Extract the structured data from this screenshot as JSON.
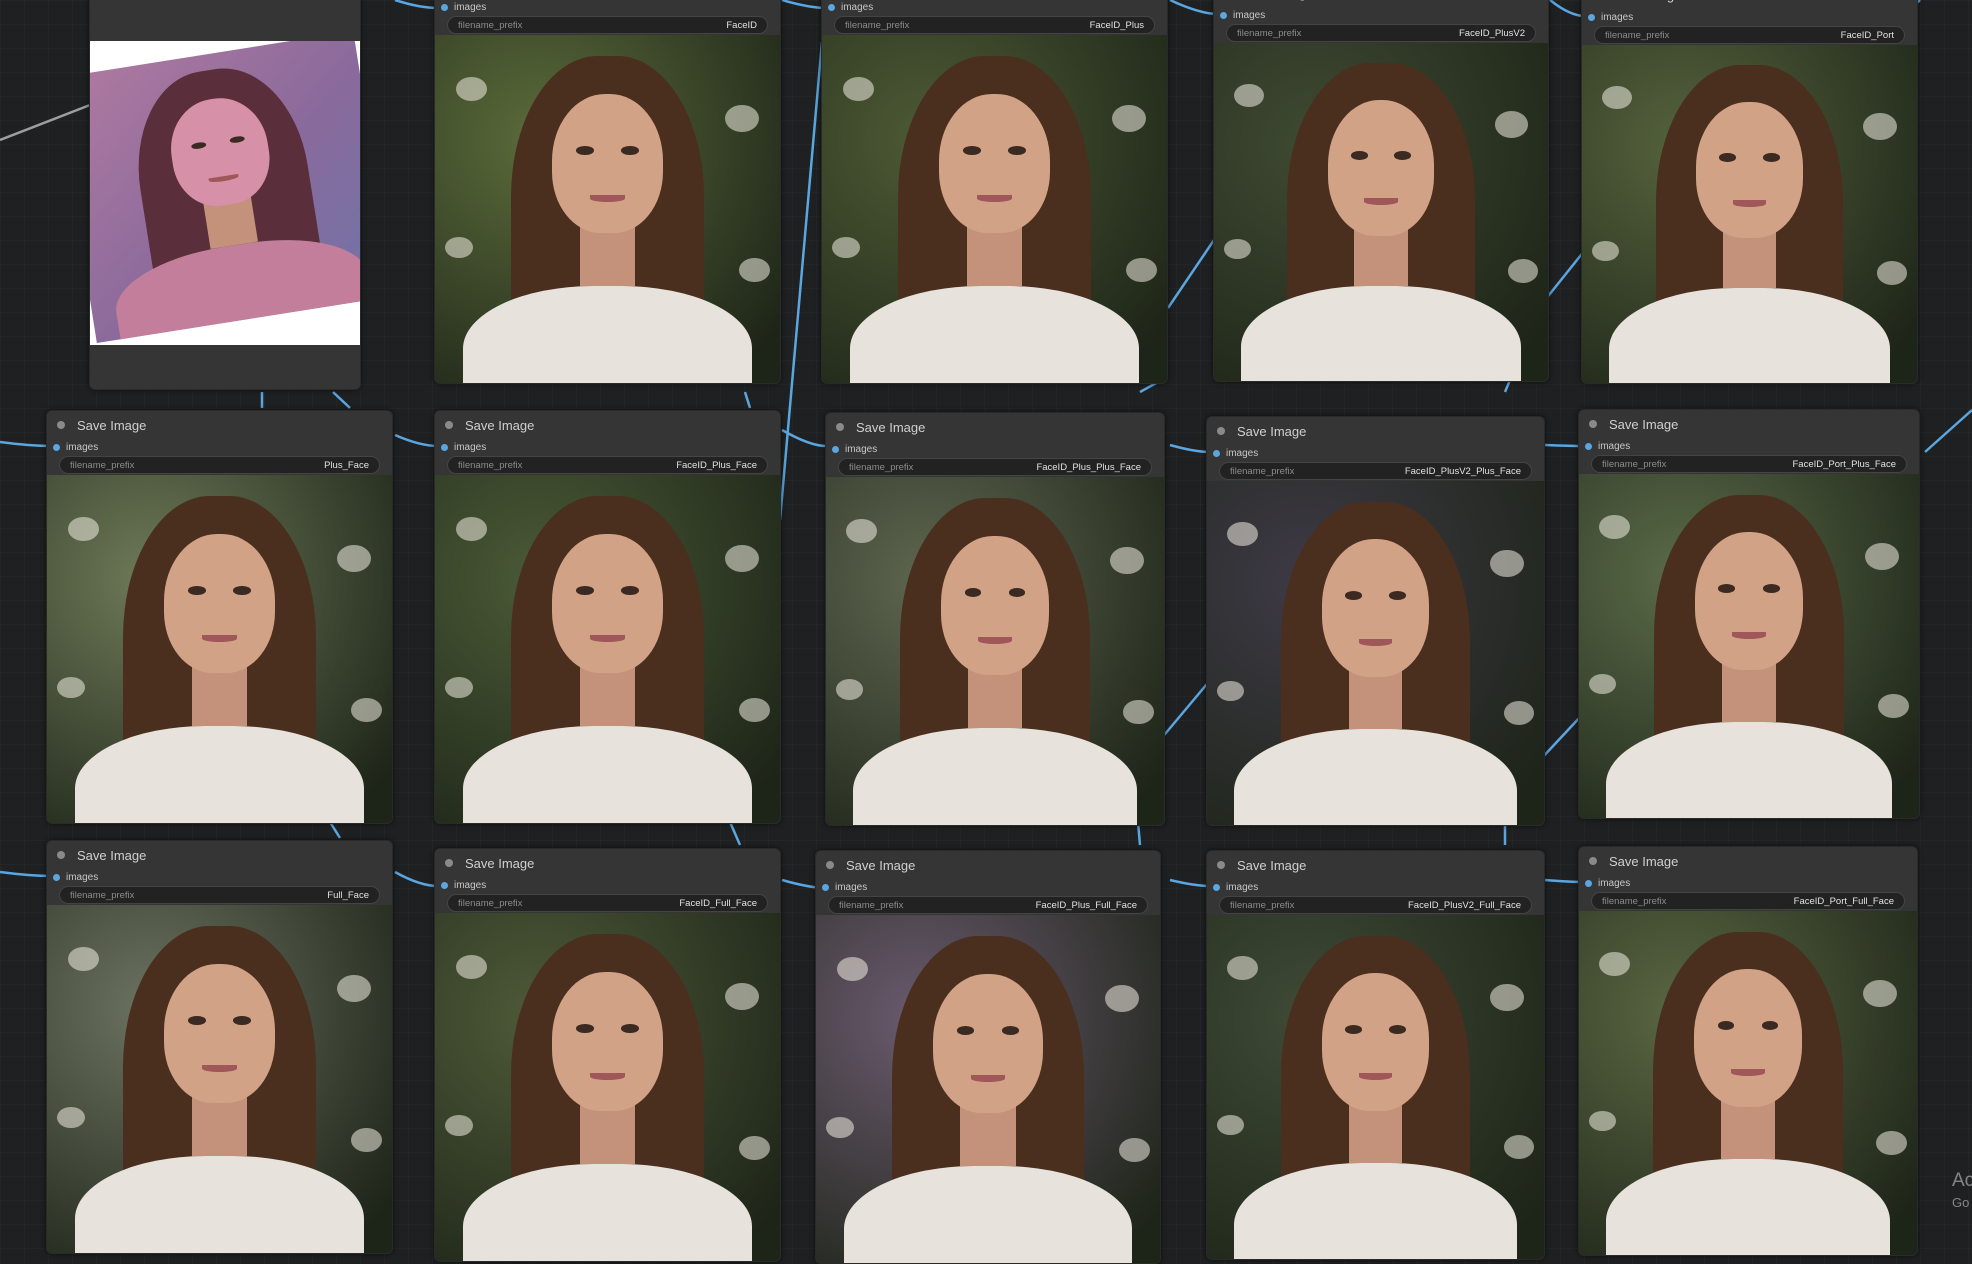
{
  "node_title": "Save Image",
  "input_label": "images",
  "widget_label": "filename_prefix",
  "load_node": {
    "description": "reference image loader",
    "image_tint": "#b07aa0"
  },
  "save_nodes": [
    {
      "prefix": "FaceID",
      "has_header": false,
      "bg": "#5b6b3a"
    },
    {
      "prefix": "FaceID_Plus",
      "has_header": false,
      "bg": "#4d5a34"
    },
    {
      "prefix": "FaceID_PlusV2",
      "has_header": false,
      "bg": "#3f4a32"
    },
    {
      "prefix": "FaceID_Port",
      "has_header": false,
      "bg": "#55623c"
    },
    {
      "prefix": "Plus_Face",
      "has_header": true,
      "bg": "#6e7a58"
    },
    {
      "prefix": "FaceID_Plus_Face",
      "has_header": true,
      "bg": "#4a5a36"
    },
    {
      "prefix": "FaceID_Plus_Plus_Face",
      "has_header": true,
      "bg": "#5e6650"
    },
    {
      "prefix": "FaceID_PlusV2_Plus_Face",
      "has_header": true,
      "bg": "#3e3a46"
    },
    {
      "prefix": "FaceID_Port_Plus_Face",
      "has_header": true,
      "bg": "#5a6a48"
    },
    {
      "prefix": "Full_Face",
      "has_header": true,
      "bg": "#6b7260"
    },
    {
      "prefix": "FaceID_Full_Face",
      "has_header": true,
      "bg": "#4e5a38"
    },
    {
      "prefix": "FaceID_Plus_Full_Face",
      "has_header": true,
      "bg": "#6a5a6e"
    },
    {
      "prefix": "FaceID_PlusV2_Full_Face",
      "has_header": true,
      "bg": "#3f4a36"
    },
    {
      "prefix": "FaceID_Port_Full_Face",
      "has_header": true,
      "bg": "#5a6642"
    }
  ],
  "watermark": {
    "line1": "Ac",
    "line2": "Go"
  },
  "colors": {
    "wire": "#5aa6e0",
    "slot": "#5aa6e0",
    "node_bg": "#353535",
    "canvas_bg": "#1f2022"
  }
}
